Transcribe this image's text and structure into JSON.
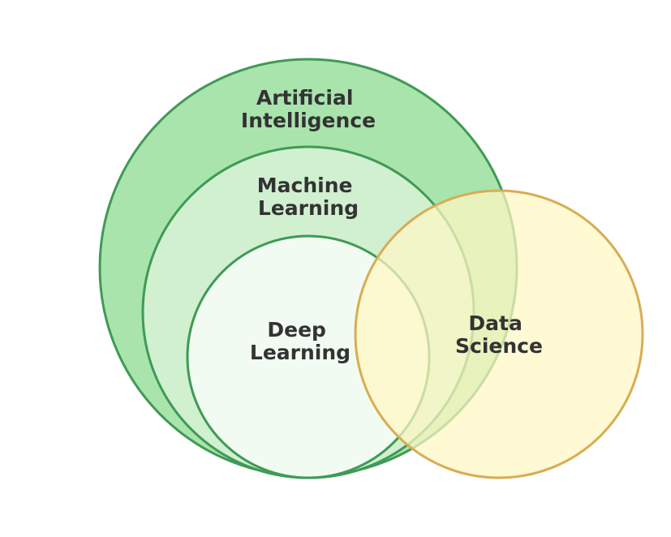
{
  "diagram": {
    "type": "nested-venn",
    "sets": {
      "ai": {
        "lines": [
          "Artificial",
          "Intelligence"
        ],
        "fill": "#a9e4ad",
        "stroke": "#3f9a55"
      },
      "ml": {
        "lines": [
          "Machine",
          "Learning"
        ],
        "fill": "#d0f0d0",
        "stroke": "#3f9a55"
      },
      "dl": {
        "lines": [
          "Deep",
          "Learning"
        ],
        "fill": "#f2fbf1",
        "stroke": "#3f9a55"
      },
      "ds": {
        "lines": [
          "Data",
          "Science"
        ],
        "fill": "#fff6c4",
        "stroke": "#d8ad52"
      }
    },
    "relations": {
      "nested": [
        "dl",
        "ml",
        "ai"
      ],
      "overlaps": "ds"
    }
  }
}
